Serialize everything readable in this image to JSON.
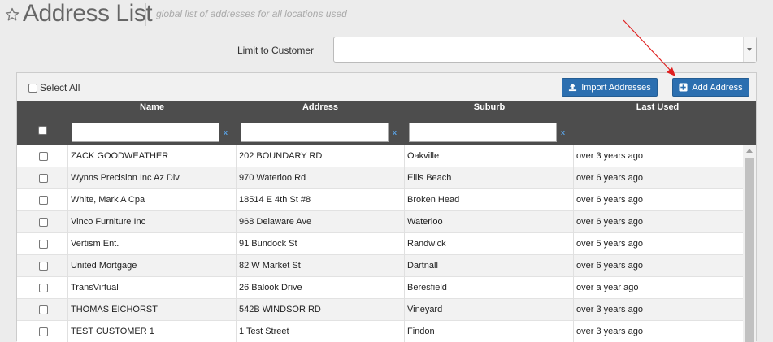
{
  "header": {
    "title": "Address List",
    "subtitle": "global list of addresses for all locations used"
  },
  "filter_bar": {
    "label": "Limit to Customer",
    "selected_value": ""
  },
  "toolbar": {
    "select_all_label": "Select All",
    "import_label": "Import Addresses",
    "add_label": "Add Address"
  },
  "table": {
    "columns": [
      "Name",
      "Address",
      "Suburb",
      "Last Used"
    ],
    "filter_clear": "x",
    "rows": [
      {
        "name": "ZACK GOODWEATHER",
        "address": "202 BOUNDARY RD",
        "suburb": "Oakville",
        "last_used": "over 3 years ago"
      },
      {
        "name": "Wynns Precision Inc Az Div",
        "address": "970 Waterloo Rd",
        "suburb": "Ellis Beach",
        "last_used": "over 6 years ago"
      },
      {
        "name": "White, Mark A Cpa",
        "address": "18514 E 4th St #8",
        "suburb": "Broken Head",
        "last_used": "over 6 years ago"
      },
      {
        "name": "Vinco Furniture Inc",
        "address": "968 Delaware Ave",
        "suburb": "Waterloo",
        "last_used": "over 6 years ago"
      },
      {
        "name": "Vertism Ent.",
        "address": "91 Bundock St",
        "suburb": "Randwick",
        "last_used": "over 5 years ago"
      },
      {
        "name": "United Mortgage",
        "address": "82 W Market St",
        "suburb": "Dartnall",
        "last_used": "over 6 years ago"
      },
      {
        "name": "TransVirtual",
        "address": "26 Balook Drive",
        "suburb": "Beresfield",
        "last_used": "over a year ago"
      },
      {
        "name": "THOMAS EICHORST",
        "address": "542B WINDSOR RD",
        "suburb": "Vineyard",
        "last_used": "over 3 years ago"
      },
      {
        "name": "TEST CUSTOMER 1",
        "address": "1 Test Street",
        "suburb": "Findon",
        "last_used": "over 3 years ago"
      }
    ]
  },
  "colors": {
    "button_blue": "#2c6fb0",
    "grid_header": "#4d4d4d",
    "annotation_arrow": "#e02020"
  }
}
